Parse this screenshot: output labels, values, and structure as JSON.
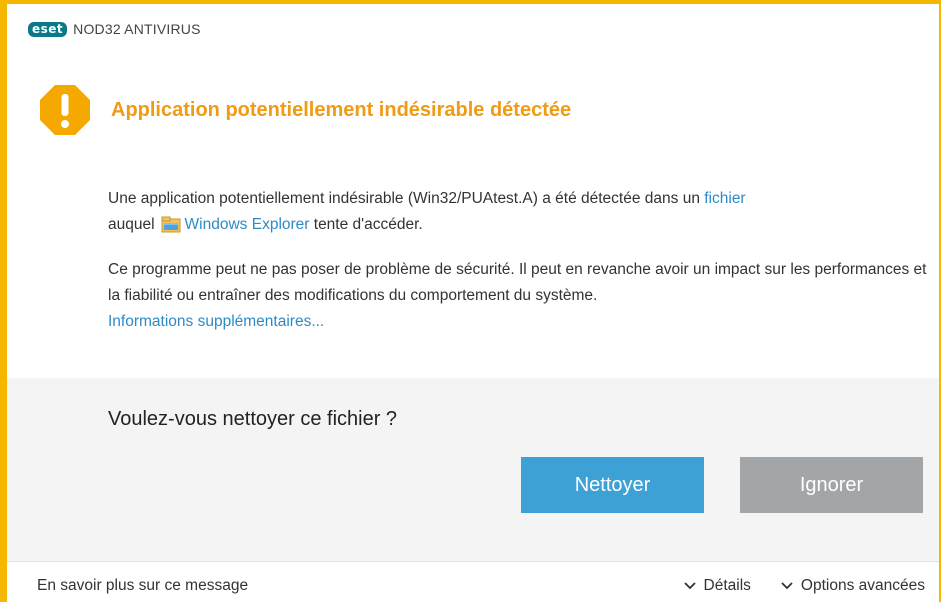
{
  "window": {
    "brand_logo": "eset",
    "app_title": "NOD32 ANTIVIRUS",
    "accent_color": "#f5b700"
  },
  "alert": {
    "icon": "warning-icon",
    "title": "Application potentiellement indésirable détectée"
  },
  "message": {
    "line1_pre": "Une application potentiellement indésirable (Win32/PUAtest.A) a été détectée dans un ",
    "file_link": "fichier",
    "line2_pre": "auquel",
    "process_icon": "windows-explorer-icon",
    "process_link": "Windows Explorer",
    "line2_post": " tente d'accéder.",
    "para2": "Ce programme peut ne pas poser de problème de sécurité. Il peut en revanche avoir un impact sur les performances et la fiabilité ou entraîner des modifications du comportement du système.",
    "more_info_link": "Informations supplémentaires..."
  },
  "action": {
    "question": "Voulez-vous nettoyer ce fichier ?",
    "clean_label": "Nettoyer",
    "ignore_label": "Ignorer"
  },
  "footer": {
    "learn_more": "En savoir plus sur ce message",
    "details_label": "Détails",
    "advanced_label": "Options avancées"
  }
}
